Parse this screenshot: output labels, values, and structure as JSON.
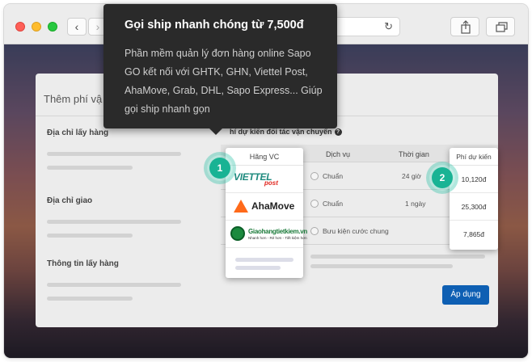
{
  "browser": {
    "back_glyph": "‹",
    "forward_glyph": "›",
    "reload_glyph": "↻",
    "share_icon": "share-icon",
    "tabs_icon": "tabs-icon"
  },
  "tooltip": {
    "title": "Gọi ship nhanh chóng từ 7,500đ",
    "body": "Phần mềm quản lý đơn hàng online Sapo GO kết nối với GHTK, GHN, Viettel Post, AhaMove, Grab, DHL, Sapo Express... Giúp gọi ship nhanh gọn"
  },
  "modal": {
    "title": "Thêm phí vậ",
    "sections": [
      "Địa chỉ lấy hàng",
      "Địa chỉ giao",
      "Thông tin lấy hàng"
    ],
    "right_heading": "hí dự kiến đối tác vận chuyển",
    "help_glyph": "?",
    "apply_label": "Áp dụng"
  },
  "table": {
    "headers": {
      "carrier": "Hãng VC",
      "service": "Dịch vụ",
      "time": "Thời gian",
      "fee": "Phí dự kiến"
    },
    "rows": [
      {
        "carrier": "viettel post",
        "service": "Chuẩn",
        "time": "24 giờ",
        "fee": "10,120đ"
      },
      {
        "carrier": "AhaMove",
        "service": "Chuẩn",
        "time": "1 ngày",
        "fee": "25,300đ"
      },
      {
        "carrier": "Giaohangtietkiem.vn",
        "service": "Bưu kiện cước chung",
        "time": "",
        "fee": "7,865đ"
      }
    ]
  },
  "logos": {
    "viettel_main": "VIETTEL",
    "viettel_sub": "post",
    "ahamove": "AhaMove",
    "ghtk_main": "Giaohangtietkiem.vn",
    "ghtk_sub": "Nhanh hơn - Rẻ hơn - Tiết kiệm hơn"
  },
  "badges": [
    "1",
    "2"
  ],
  "colors": {
    "accent": "#19b394",
    "apply_button": "#0e5fb3",
    "tooltip_bg": "#2a2a2a"
  }
}
